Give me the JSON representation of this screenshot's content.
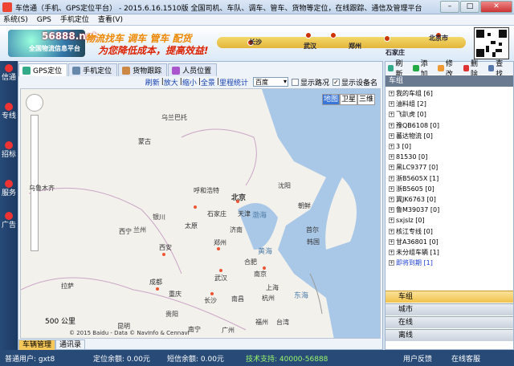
{
  "window": {
    "title": "车信通（手机、GPS定位平台） - 2015.6.16.1510版 全国司机、车队、调车、管车、货物等定位，在线跟踪、通信及管理平台"
  },
  "menu": [
    "系统(S)",
    "GPS",
    "手机定位",
    "查看(V)"
  ],
  "banner": {
    "site": "56888.net",
    "sub": "全国物流信息平台",
    "slogan1": "物流找车 调车 管车 配货",
    "slogan2": "为您降低成本，提高效益!",
    "cities": [
      "长沙",
      "武汉",
      "郑州",
      "石家庄",
      "北京市"
    ]
  },
  "sidebar": [
    "信通",
    "专线",
    "招标",
    "服务",
    "广告"
  ],
  "tabs": [
    "GPS定位",
    "手机定位",
    "货物跟踪",
    "人员位置"
  ],
  "toolbar": {
    "links": [
      "刷新",
      "放大",
      "缩小",
      "全景",
      "里程统计"
    ],
    "map_select": "百度",
    "cb1": "显示路况",
    "cb2": "显示设备名"
  },
  "map": {
    "types": [
      "地图",
      "卫星",
      "三维"
    ],
    "scale": "500 公里",
    "copyright": "© 2015 Baidu - Data © NavInfo & CennavI",
    "seas": [
      "黄海",
      "东海",
      "渤海"
    ],
    "labels": [
      "蒙古",
      "乌兰巴托",
      "呼和浩特",
      "北京",
      "天津",
      "石家庄",
      "太原",
      "济南",
      "郑州",
      "西安",
      "兰州",
      "银川",
      "西宁",
      "武汉",
      "南京",
      "上海",
      "杭州",
      "长沙",
      "南昌",
      "福州",
      "成都",
      "重庆",
      "贵阳",
      "昆明",
      "南宁",
      "广州",
      "沈阳",
      "朝鲜",
      "首尔",
      "韩国",
      "台湾",
      "合肥",
      "拉萨",
      "乌鲁木齐"
    ]
  },
  "bottomtabs": [
    "车辆管理",
    "通讯录"
  ],
  "right": {
    "tools": [
      "刷新",
      "添加",
      "修改",
      "删除",
      "查找"
    ],
    "header": "车组",
    "tree": [
      "我的车组 [6]",
      "油料组 [2]",
      "飞趴虎 [0]",
      "豫QB6108 [0]",
      "蕃达物流 [0]",
      "3 [0]",
      "81530 [0]",
      "黑LC9377 [0]",
      "浙B5605X [1]",
      "浙B5605 [0]",
      "冀JK6763 [0]",
      "鲁M39037 [0]",
      "sxjslz [0]",
      "核江专线 [0]",
      "甘A36801 [0]",
      "未分组车辆 [1]",
      "即将到期 [1]"
    ],
    "accordion": [
      "车组",
      "城市",
      "在线",
      "离线"
    ]
  },
  "status": {
    "user": "普通用户: gxt8",
    "pos_balance": "定位余额: 0.00元",
    "sms_balance": "短信余额: 0.00元",
    "support": "技术支持: 40000-56888",
    "feedback": "用户反馈",
    "service": "在线客服"
  }
}
